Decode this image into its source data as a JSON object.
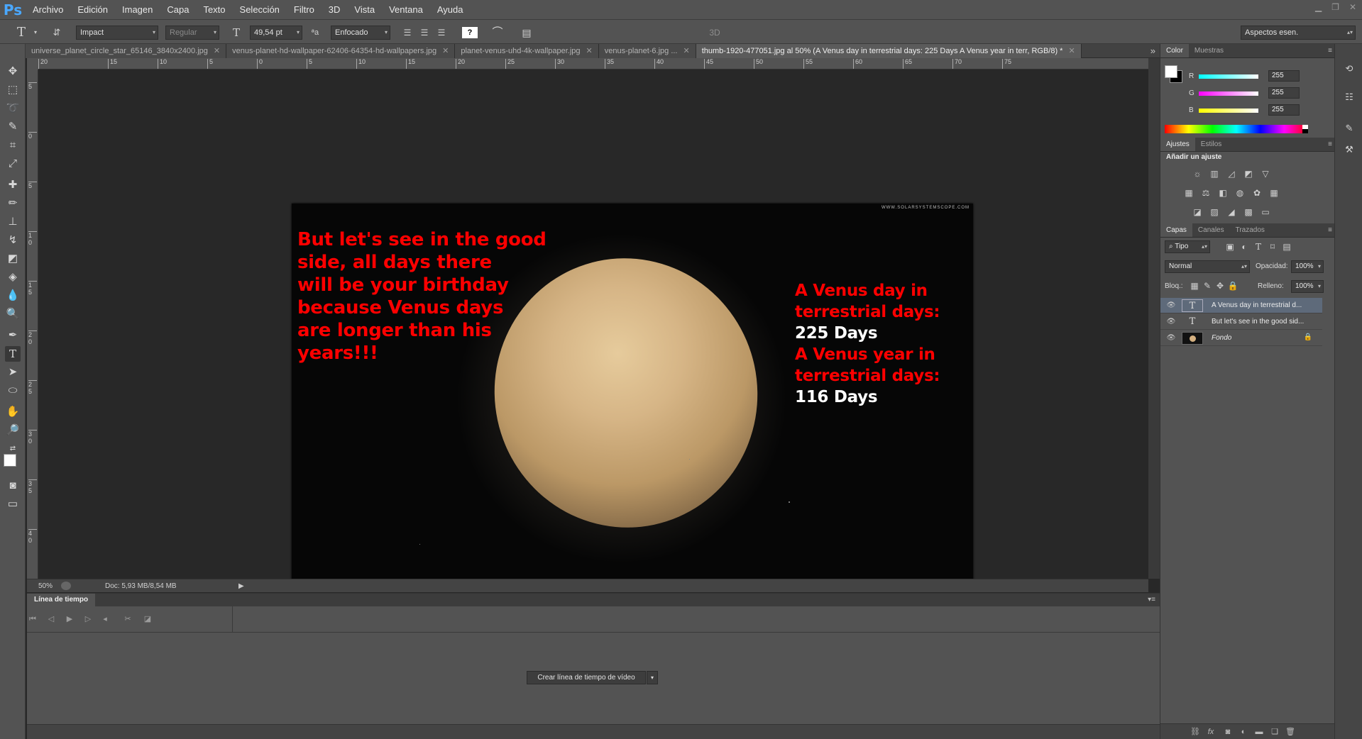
{
  "app": {
    "logo": "Ps"
  },
  "menu": [
    "Archivo",
    "Edición",
    "Imagen",
    "Capa",
    "Texto",
    "Selección",
    "Filtro",
    "3D",
    "Vista",
    "Ventana",
    "Ayuda"
  ],
  "options": {
    "font_family": "Impact",
    "font_style": "Regular",
    "font_size": "49,54 pt",
    "antialias": "Enfocado",
    "mode_3d": "3D",
    "workspace": "Aspectos esen."
  },
  "tabs": [
    {
      "label": "universe_planet_circle_star_65146_3840x2400.jpg"
    },
    {
      "label": "venus-planet-hd-wallpaper-62406-64354-hd-wallpapers.jpg"
    },
    {
      "label": "planet-venus-uhd-4k-wallpaper.jpg"
    },
    {
      "label": "venus-planet-6.jpg ..."
    },
    {
      "label": "thumb-1920-477051.jpg al 50% (A Venus day in  terrestrial days: 225 Days A Venus year in terr, RGB/8) *"
    }
  ],
  "rulers": {
    "h_ticks": [
      "20",
      "15",
      "10",
      "5",
      "0",
      "5",
      "10",
      "15",
      "20",
      "25",
      "30",
      "35",
      "40",
      "45",
      "50",
      "55",
      "60",
      "65",
      "70",
      "75"
    ],
    "v_ticks": [
      "5",
      "0",
      "5",
      "1 0",
      "1 5",
      "2 0",
      "2 5",
      "3 0",
      "3 5",
      "4 0"
    ]
  },
  "document": {
    "watermark": "WWW.SOLARSYSTEMSCOPE.COM",
    "left_lines": [
      "But let's see in the good",
      "side, all days there",
      "will be your birthday",
      "because Venus days",
      "are longer than his",
      "years!!!"
    ],
    "right_red_1": [
      "A Venus day in",
      "terrestrial days:"
    ],
    "right_white_1": "225 Days",
    "right_red_2": [
      "A Venus year in",
      "terrestrial days:"
    ],
    "right_white_2": "116 Days"
  },
  "status": {
    "zoom": "50%",
    "doc_info": "Doc: 5,93 MB/8,54 MB"
  },
  "timeline": {
    "title": "Línea de tiempo",
    "create_button": "Crear línea de tiempo de vídeo"
  },
  "color_panel": {
    "tabs": [
      "Color",
      "Muestras"
    ],
    "r_label": "R",
    "r": "255",
    "g_label": "G",
    "g": "255",
    "b_label": "B",
    "b": "255"
  },
  "adjust_panel": {
    "tabs": [
      "Ajustes",
      "Estilos"
    ],
    "title": "Añadir un ajuste"
  },
  "layers_panel": {
    "tabs": [
      "Capas",
      "Canales",
      "Trazados"
    ],
    "filter": "Tipo",
    "blend_mode": "Normal",
    "opacity_label": "Opacidad:",
    "opacity": "100%",
    "lock_label": "Bloq.:",
    "fill_label": "Relleno:",
    "fill": "100%",
    "layers": [
      {
        "name": "A Venus day in  terrestrial d...",
        "type": "text",
        "selected": true
      },
      {
        "name": "But let's see in the good sid...",
        "type": "text",
        "selected": false
      },
      {
        "name": "Fondo",
        "type": "image",
        "selected": false
      }
    ]
  },
  "colors": {
    "accent": "#4aa8ff",
    "text_red": "#ff0000",
    "selected_layer": "#5e6a7a"
  }
}
